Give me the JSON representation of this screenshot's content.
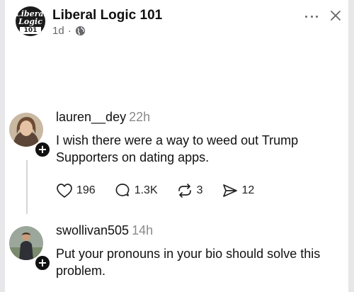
{
  "page": {
    "name": "Liberal Logic 101",
    "time": "1d",
    "separator": "·",
    "logo_text": {
      "line1": "Liberal",
      "line2": "Logic",
      "line3": "101"
    }
  },
  "posts": [
    {
      "username": "lauren__dey",
      "time": "22h",
      "text": "I wish there were a way to weed out Trump Supporters on dating apps.",
      "actions": {
        "likes": "196",
        "comments": "1.3K",
        "reposts": "3",
        "shares": "12"
      }
    },
    {
      "username": "swollivan505",
      "time": "14h",
      "text": "Put your pronouns in your bio should solve this problem."
    }
  ],
  "icons": {
    "globe": "globe-icon",
    "more": "more-options-icon",
    "close": "close-icon",
    "like": "heart-icon",
    "comment": "comment-icon",
    "repost": "repost-icon",
    "share": "share-icon",
    "follow": "plus-icon"
  },
  "colors": {
    "frame": "#e7e7e9",
    "muted": "#65676b",
    "text": "#111111"
  }
}
